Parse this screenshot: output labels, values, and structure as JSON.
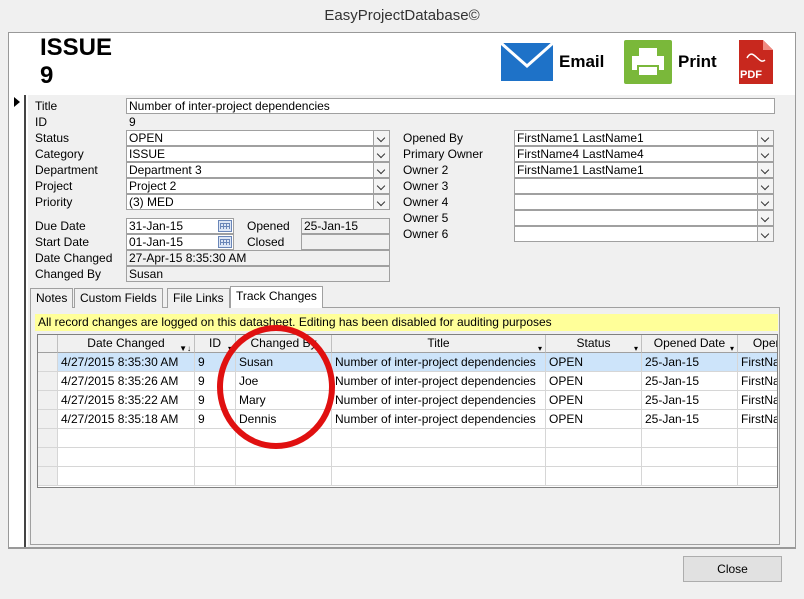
{
  "window": {
    "title": "EasyProjectDatabase©"
  },
  "header": {
    "record_type": "ISSUE",
    "record_id": "9",
    "email_label": "Email",
    "print_label": "Print",
    "pdf_label": "PDF"
  },
  "labels": {
    "title": "Title",
    "id": "ID",
    "status": "Status",
    "category": "Category",
    "department": "Department",
    "project": "Project",
    "priority": "Priority",
    "due_date": "Due Date",
    "start_date": "Start Date",
    "date_changed": "Date Changed",
    "changed_by": "Changed By",
    "opened": "Opened",
    "closed": "Closed",
    "opened_by": "Opened By",
    "primary_owner": "Primary Owner",
    "owner2": "Owner 2",
    "owner3": "Owner 3",
    "owner4": "Owner 4",
    "owner5": "Owner 5",
    "owner6": "Owner 6"
  },
  "values": {
    "title": "Number of inter-project dependencies",
    "id": "9",
    "status": "OPEN",
    "category": "ISSUE",
    "department": "Department 3",
    "project": "Project 2",
    "priority": "(3) MED",
    "due_date": "31-Jan-15",
    "start_date": "01-Jan-15",
    "date_changed": "27-Apr-15 8:35:30 AM",
    "changed_by": "Susan",
    "opened": "25-Jan-15",
    "closed": "",
    "opened_by": "FirstName1 LastName1",
    "primary_owner": "FirstName4 LastName4",
    "owner2": "FirstName1 LastName1",
    "owner3": "",
    "owner4": "",
    "owner5": "",
    "owner6": ""
  },
  "tabs": [
    "Notes",
    "Custom Fields",
    "File Links",
    "Track Changes"
  ],
  "notice": "All record changes are logged on this datasheet.  Editing has been disabled for auditing purposes",
  "grid": {
    "columns": [
      "Date Changed",
      "ID",
      "Changed By",
      "Title",
      "Status",
      "Opened Date",
      "Open"
    ],
    "rows": [
      [
        "4/27/2015 8:35:30 AM",
        "9",
        "Susan",
        "Number of inter-project dependencies",
        "OPEN",
        "25-Jan-15",
        "FirstNa"
      ],
      [
        "4/27/2015 8:35:26 AM",
        "9",
        "Joe",
        "Number of inter-project dependencies",
        "OPEN",
        "25-Jan-15",
        "FirstNa"
      ],
      [
        "4/27/2015 8:35:22 AM",
        "9",
        "Mary",
        "Number of inter-project dependencies",
        "OPEN",
        "25-Jan-15",
        "FirstNa"
      ],
      [
        "4/27/2015 8:35:18 AM",
        "9",
        "Dennis",
        "Number of inter-project dependencies",
        "OPEN",
        "25-Jan-15",
        "FirstNa"
      ]
    ]
  },
  "footer": {
    "close_label": "Close"
  },
  "colors": {
    "email_blue": "#1e72c8",
    "print_green": "#7ab83a",
    "pdf_red": "#c8281e",
    "highlight_circle": "#e01010"
  }
}
